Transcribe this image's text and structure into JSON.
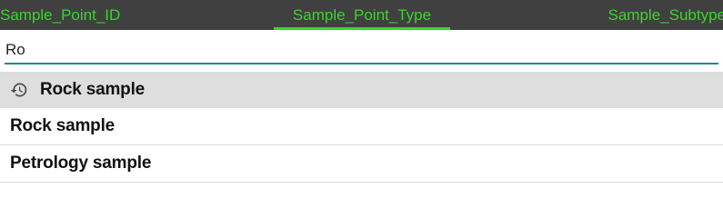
{
  "tabs": [
    {
      "label": "Sample_Point_ID"
    },
    {
      "label": "Sample_Point_Type"
    },
    {
      "label": "Sample_Subtype"
    }
  ],
  "active_tab": "Sample_Point_Type",
  "search": {
    "value": "Ro"
  },
  "suggestions": {
    "recent": {
      "label": "Rock sample",
      "icon": "history-icon"
    },
    "items": [
      {
        "label": "Rock sample"
      },
      {
        "label": "Petrology sample"
      }
    ]
  },
  "colors": {
    "tab_bar_bg": "#404040",
    "tab_text": "#39d62a",
    "input_underline": "#1f8c8c",
    "recent_row_bg": "#dedede"
  }
}
